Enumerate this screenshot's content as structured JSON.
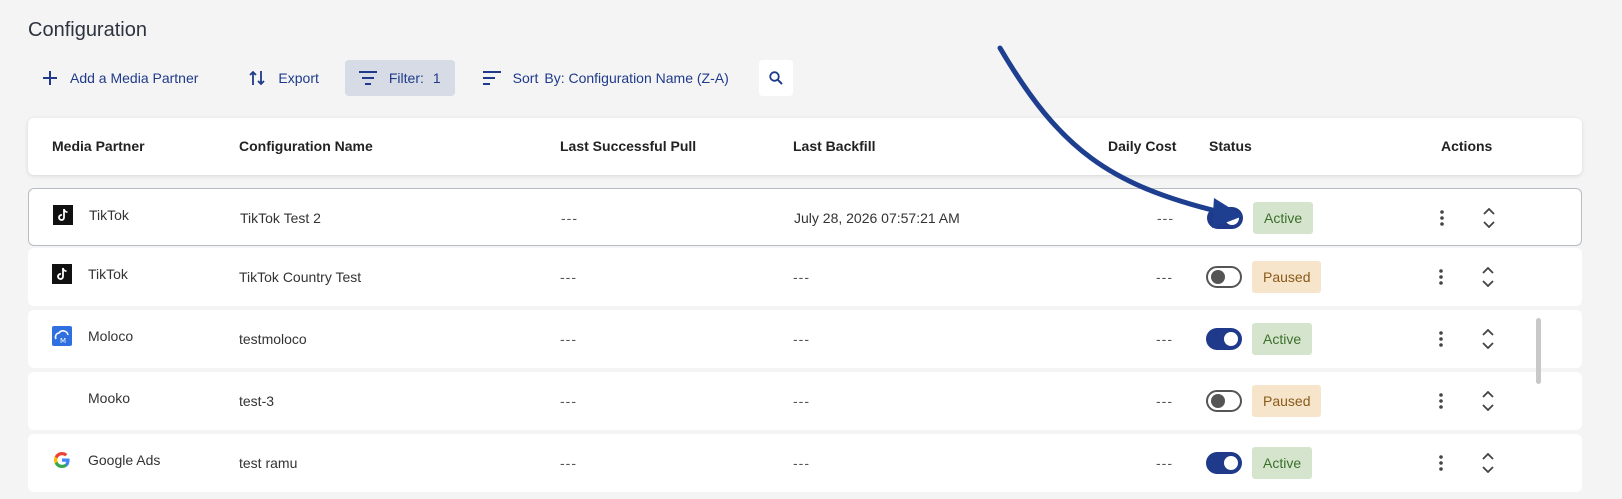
{
  "page": {
    "title": "Configuration"
  },
  "toolbar": {
    "add_label": "Add a Media Partner",
    "export_label": "Export",
    "filter_label": "Filter:",
    "filter_count": "1",
    "sort_label": "Sort",
    "sort_value": "By: Configuration Name (Z-A)"
  },
  "table": {
    "headers": {
      "media_partner": "Media Partner",
      "configuration_name": "Configuration Name",
      "last_successful_pull": "Last Successful Pull",
      "last_backfill": "Last Backfill",
      "daily_cost": "Daily Cost",
      "status": "Status",
      "actions": "Actions"
    },
    "rows": [
      {
        "partner": "TikTok",
        "logo": "tiktok-logo",
        "config": "TikTok Test 2",
        "last_pull": "---",
        "last_backfill": "July 28, 2026 07:57:21 AM",
        "daily_cost": "---",
        "status": "Active",
        "enabled": true
      },
      {
        "partner": "TikTok",
        "logo": "tiktok-logo",
        "config": "TikTok Country Test",
        "last_pull": "---",
        "last_backfill": "---",
        "daily_cost": "---",
        "status": "Paused",
        "enabled": false
      },
      {
        "partner": "Moloco",
        "logo": "moloco-logo",
        "config": "testmoloco",
        "last_pull": "---",
        "last_backfill": "---",
        "daily_cost": "---",
        "status": "Active",
        "enabled": true
      },
      {
        "partner": "Mooko",
        "logo": "",
        "config": "test-3",
        "last_pull": "---",
        "last_backfill": "---",
        "daily_cost": "---",
        "status": "Paused",
        "enabled": false
      },
      {
        "partner": "Google Ads",
        "logo": "google-ads-logo",
        "config": "test ramu",
        "last_pull": "---",
        "last_backfill": "---",
        "daily_cost": "---",
        "status": "Active",
        "enabled": true
      }
    ]
  },
  "colors": {
    "accent": "#1f3a8a",
    "active_bg": "#d5e5cd",
    "active_text": "#3c6e2b",
    "paused_bg": "#f6e4cb",
    "paused_text": "#8a5a1a",
    "annotation_arrow": "#1e3f8f"
  }
}
